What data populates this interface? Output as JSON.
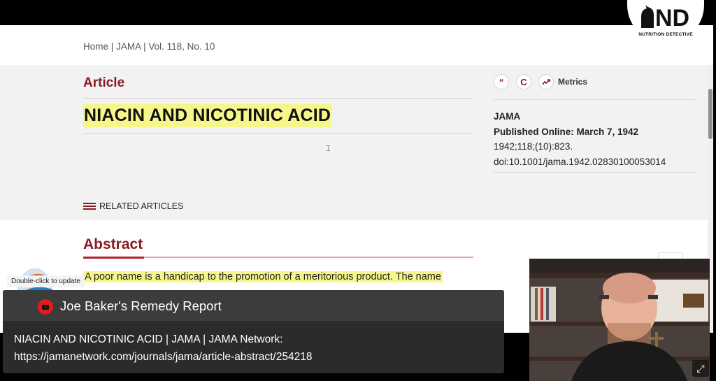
{
  "breadcrumb": {
    "home": "Home",
    "journal": "JAMA",
    "volume": "Vol. 118, No. 10",
    "sep": "|"
  },
  "article": {
    "type_label": "Article",
    "title": "NIACIN AND NICOTINIC ACID",
    "related_label": "RELATED ARTICLES"
  },
  "sidebar": {
    "cite_icon": "“",
    "c_icon": "C",
    "metrics_label": "Metrics",
    "journal": "JAMA",
    "published": "Published Online: March 7, 1942",
    "citation": "1942;118;(10):823.",
    "doi": "doi:10.1001/jama.1942.02830100053014"
  },
  "abstract": {
    "heading": "Abstract",
    "text": "A poor name is a handicap to the promotion of a meritorious product. The name"
  },
  "logo": {
    "mark": "ND",
    "caption": "NUTRITION DETECTIVE"
  },
  "overlay": {
    "double_click_label": "Double-click to update",
    "channel_title": "Joe Baker's Remedy Report",
    "description_line1": "NIACIN AND NICOTINIC ACID | JAMA | JAMA Network:",
    "description_line2": "https://jamanetwork.com/journals/jama/article-abstract/254218"
  },
  "colors": {
    "brand_red": "#8a1b22",
    "highlight": "#f7f68b"
  }
}
